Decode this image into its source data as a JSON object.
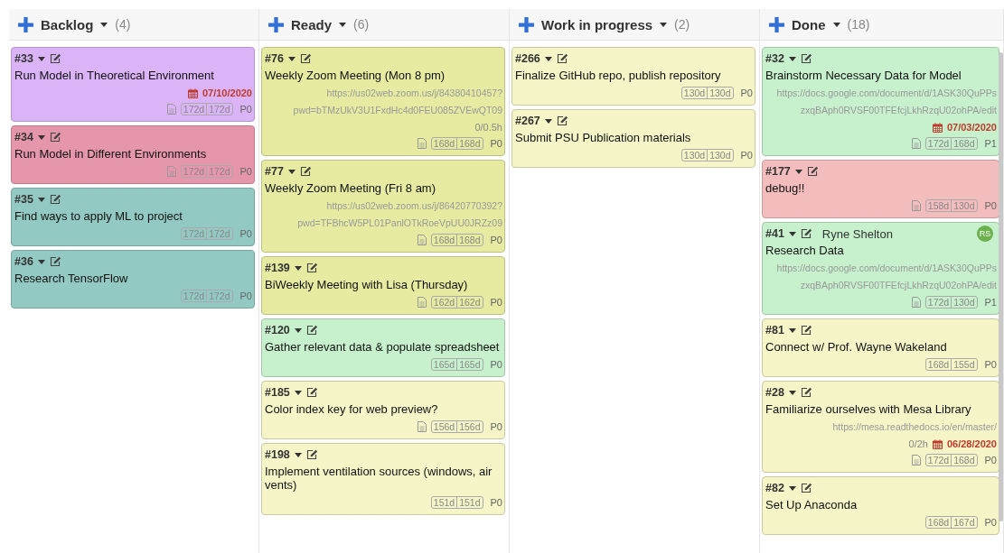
{
  "columns": [
    {
      "title": "Backlog",
      "count": "(4)",
      "cards": [
        {
          "number": "#33",
          "title": "Run Model in Theoretical Environment",
          "color": "#dab4f7",
          "due": "07/10/2020",
          "doc": true,
          "ages": [
            "172d",
            "172d"
          ],
          "priority": "P0"
        },
        {
          "number": "#34",
          "title": "Run Model in Different Environments",
          "color": "#e596ab",
          "doc": true,
          "ages": [
            "172d",
            "172d"
          ],
          "priority": "P0"
        },
        {
          "number": "#35",
          "title": "Find ways to apply ML to project",
          "color": "#93c9c3",
          "doc": false,
          "ages": [
            "172d",
            "172d"
          ],
          "priority": "P0"
        },
        {
          "number": "#36",
          "title": "Research TensorFlow",
          "color": "#93c9c3",
          "doc": false,
          "ages": [
            "172d",
            "172d"
          ],
          "priority": "P0"
        }
      ]
    },
    {
      "title": "Ready",
      "count": "(6)",
      "cards": [
        {
          "number": "#76",
          "title": "Weekly Zoom Meeting (Mon 8 pm)",
          "color": "#e6eba1",
          "links": [
            "https://us02web.zoom.us/j/84380410457?",
            "pwd=bTMzUkV3U1FxdHc4d0FEU085ZVEwQT09"
          ],
          "hours": "0/0.5h",
          "doc": true,
          "ages": [
            "168d",
            "168d"
          ],
          "priority": "P0"
        },
        {
          "number": "#77",
          "title": "Weekly Zoom Meeting (Fri 8 am)",
          "color": "#e6eba1",
          "links": [
            "https://us02web.zoom.us/j/86420770392?",
            "pwd=TFBhcW5PL01PanlOTkRoeVpUU0JRZz09"
          ],
          "doc": true,
          "ages": [
            "168d",
            "168d"
          ],
          "priority": "P0"
        },
        {
          "number": "#139",
          "title": "BiWeekly Meeting with Lisa (Thursday)",
          "color": "#e6eba1",
          "doc": true,
          "ages": [
            "162d",
            "162d"
          ],
          "priority": "P0"
        },
        {
          "number": "#120",
          "title": "Gather relevant data & populate spreadsheet",
          "color": "#c7f1cd",
          "doc": false,
          "ages": [
            "165d",
            "165d"
          ],
          "priority": "P0"
        },
        {
          "number": "#185",
          "title": "Color index key for web preview?",
          "color": "#f5f5c7",
          "doc": true,
          "ages": [
            "156d",
            "156d"
          ],
          "priority": "P0"
        },
        {
          "number": "#198",
          "title": "Implement ventilation sources (windows, air vents)",
          "color": "#f5f5c7",
          "doc": false,
          "ages": [
            "151d",
            "151d"
          ],
          "priority": "P0"
        }
      ]
    },
    {
      "title": "Work in progress",
      "count": "(2)",
      "cards": [
        {
          "number": "#266",
          "title": "Finalize GitHub repo, publish repository",
          "color": "#f5f5c7",
          "doc": false,
          "ages": [
            "130d",
            "130d"
          ],
          "priority": "P0"
        },
        {
          "number": "#267",
          "title": "Submit PSU Publication materials",
          "color": "#f5f5c7",
          "doc": false,
          "ages": [
            "130d",
            "130d"
          ],
          "priority": "P0"
        }
      ]
    },
    {
      "title": "Done",
      "count": "(18)",
      "cards": [
        {
          "number": "#32",
          "title": "Brainstorm Necessary Data for Model",
          "color": "#c7f1cd",
          "links": [
            "https://docs.google.com/document/d/1ASK30QuPPs",
            "zxqBAph0RVSF00TFEfcjLkhRzqU02ohPA/edit"
          ],
          "due": "07/03/2020",
          "doc": true,
          "ages": [
            "172d",
            "168d"
          ],
          "priority": "P1"
        },
        {
          "number": "#177",
          "title": "debug!!",
          "color": "#f4bdbd",
          "doc": true,
          "ages": [
            "158d",
            "130d"
          ],
          "priority": "P0"
        },
        {
          "number": "#41",
          "assignee": "Ryne Shelton",
          "avatar": "RS",
          "title": "Research Data",
          "color": "#c7f1cd",
          "links": [
            "https://docs.google.com/document/d/1ASK30QuPPs",
            "zxqBAph0RVSF00TFEfcjLkhRzqU02ohPA/edit"
          ],
          "doc": true,
          "ages": [
            "172d",
            "130d"
          ],
          "priority": "P1"
        },
        {
          "number": "#81",
          "title": "Connect w/ Prof. Wayne Wakeland",
          "color": "#f5f5c7",
          "doc": false,
          "ages": [
            "168d",
            "155d"
          ],
          "priority": "P0"
        },
        {
          "number": "#28",
          "title": "Familiarize ourselves with Mesa Library",
          "color": "#f5f5c7",
          "links": [
            "https://mesa.readthedocs.io/en/master/"
          ],
          "hours": "0/2h",
          "due": "06/28/2020",
          "doc": true,
          "ages": [
            "172d",
            "168d"
          ],
          "priority": "P0"
        },
        {
          "number": "#82",
          "title": "Set Up Anaconda",
          "color": "#f5f5c7",
          "doc": false,
          "ages": [
            "168d",
            "167d"
          ],
          "priority": "P0"
        }
      ]
    }
  ]
}
